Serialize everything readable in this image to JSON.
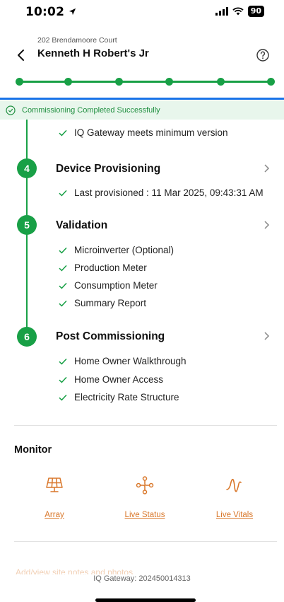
{
  "status_bar": {
    "time": "10:02",
    "battery": "90"
  },
  "header": {
    "subtitle": "202 Brendamoore Court",
    "title": "Kenneth H Robert's Jr"
  },
  "progress": {
    "steps_total": 6,
    "steps_completed": 6
  },
  "banner": {
    "text": "Commissioning Completed Successfully"
  },
  "steps": [
    {
      "partial_item": "IQ Gateway meets minimum version"
    },
    {
      "number": "4",
      "title": "Device Provisioning",
      "items": [
        "Last provisioned : 11 Mar 2025, 09:43:31 AM"
      ]
    },
    {
      "number": "5",
      "title": "Validation",
      "items": [
        "Microinverter (Optional)",
        "Production Meter",
        "Consumption Meter",
        "Summary Report"
      ]
    },
    {
      "number": "6",
      "title": "Post Commissioning",
      "items": [
        "Home Owner Walkthrough",
        "Home Owner Access",
        "Electricity Rate Structure"
      ]
    }
  ],
  "monitor": {
    "title": "Monitor",
    "items": [
      {
        "label": "Array",
        "icon": "solar-panel-icon"
      },
      {
        "label": "Live Status",
        "icon": "flow-nodes-icon"
      },
      {
        "label": "Live Vitals",
        "icon": "pulse-icon"
      }
    ]
  },
  "footer": {
    "partial_link": "Add/view site notes and photos",
    "gateway": "IQ Gateway: 202450014313"
  },
  "colors": {
    "accent_green": "#18a046",
    "accent_blue": "#1a73e8",
    "banner_bg": "#e8f6ec",
    "orange": "#d9772a"
  }
}
